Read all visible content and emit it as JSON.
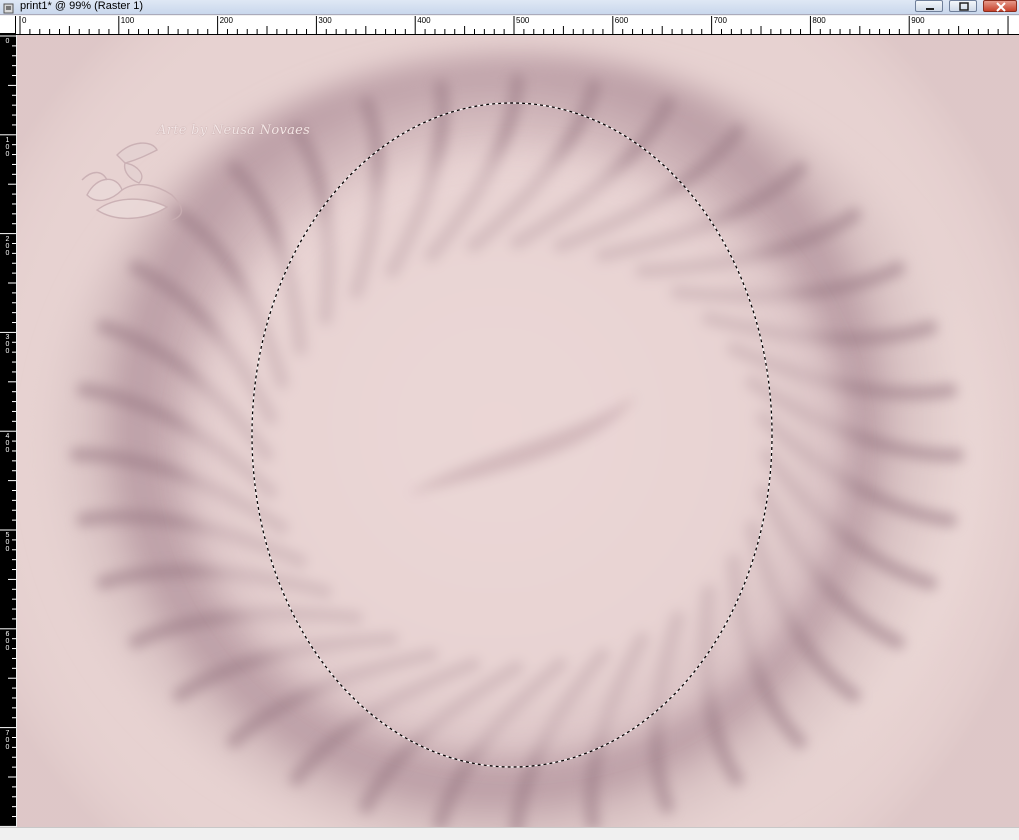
{
  "window": {
    "title": "print1* @  99% (Raster 1)"
  },
  "ruler": {
    "horizontal_labels": [
      "0",
      "100",
      "200",
      "300",
      "400",
      "500",
      "600",
      "700",
      "800",
      "900"
    ],
    "vertical_labels": [
      [
        "0"
      ],
      [
        "1",
        "0",
        "0"
      ],
      [
        "2",
        "0",
        "0"
      ],
      [
        "3",
        "0",
        "0"
      ],
      [
        "4",
        "0",
        "0"
      ],
      [
        "5",
        "0",
        "0"
      ],
      [
        "6",
        "0",
        "0"
      ],
      [
        "7",
        "0",
        "0"
      ]
    ]
  },
  "canvas": {
    "watermark": "Arte by   Neusa Novaes",
    "colors": {
      "base": "#e6cfcf",
      "dark": "#8c6a75",
      "light": "#efdcda"
    },
    "selection": "ellipse-marquee"
  }
}
